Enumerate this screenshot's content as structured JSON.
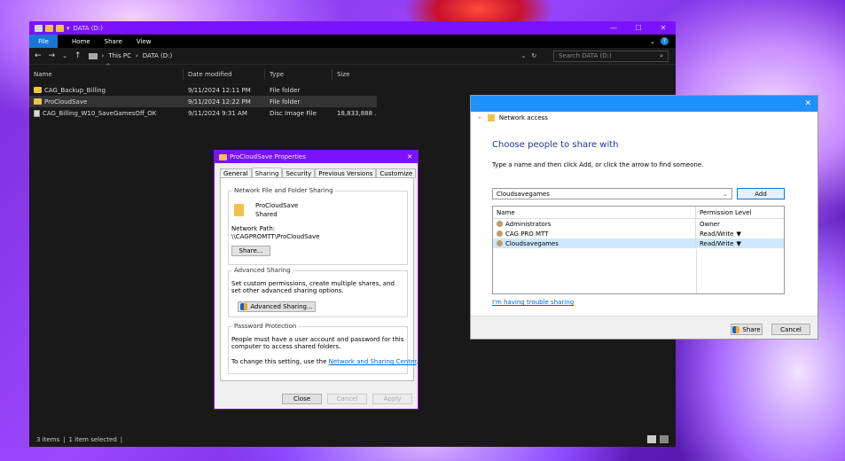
{
  "explorer": {
    "title": "DATA (D:)",
    "ribbon": {
      "file": "File",
      "tabs": [
        "Home",
        "Share",
        "View"
      ]
    },
    "breadcrumb": [
      "This PC",
      "DATA (D:)"
    ],
    "search_placeholder": "Search DATA (D:)",
    "columns": [
      "Name",
      "Date modified",
      "Type",
      "Size"
    ],
    "rows": [
      {
        "name": "CAG_Backup_Billing",
        "date": "9/11/2024 12:11 PM",
        "type": "File folder",
        "size": ""
      },
      {
        "name": "ProCloudSave",
        "date": "9/11/2024 12:22 PM",
        "type": "File folder",
        "size": ""
      },
      {
        "name": "CAG_Billing_W10_SaveGamesOff_OK",
        "date": "9/11/2024 9:31 AM",
        "type": "Disc Image File",
        "size": "18,833,888 ..."
      }
    ],
    "status": {
      "items": "3 items",
      "selected": "1 item selected"
    }
  },
  "properties": {
    "title": "ProCloudSave Properties",
    "tabs": [
      "General",
      "Sharing",
      "Security",
      "Previous Versions",
      "Customize"
    ],
    "nfs_label": "Network File and Folder Sharing",
    "folder_name": "ProCloudSave",
    "folder_state": "Shared",
    "path_label": "Network Path:",
    "path_value": "\\\\CAGPROMTT\\ProCloudSave",
    "share_btn": "Share...",
    "adv_label": "Advanced Sharing",
    "adv_desc": "Set custom permissions, create multiple shares, and set other advanced sharing options.",
    "adv_btn": "Advanced Sharing...",
    "pw_label": "Password Protection",
    "pw_desc": "People must have a user account and password for this computer to access shared folders.",
    "pw_change_prefix": "To change this setting, use the",
    "pw_link": "Network and Sharing Center",
    "pw_change_suffix": ".",
    "buttons": {
      "close": "Close",
      "cancel": "Cancel",
      "apply": "Apply"
    }
  },
  "network": {
    "title": "Network access",
    "heading": "Choose people to share with",
    "instruction": "Type a name and then click Add, or click the arrow to find someone.",
    "input_value": "Cloudsavegames",
    "add_btn": "Add",
    "columns": [
      "Name",
      "Permission Level"
    ],
    "rows": [
      {
        "name": "Administrators",
        "perm": "Owner",
        "arrow": ""
      },
      {
        "name": "CAG PRO MTT",
        "perm": "Read/Write",
        "arrow": "▼"
      },
      {
        "name": "Cloudsavegames",
        "perm": "Read/Write",
        "arrow": "▼"
      }
    ],
    "trouble_link": "I'm having trouble sharing",
    "share_btn": "Share",
    "cancel_btn": "Cancel"
  }
}
